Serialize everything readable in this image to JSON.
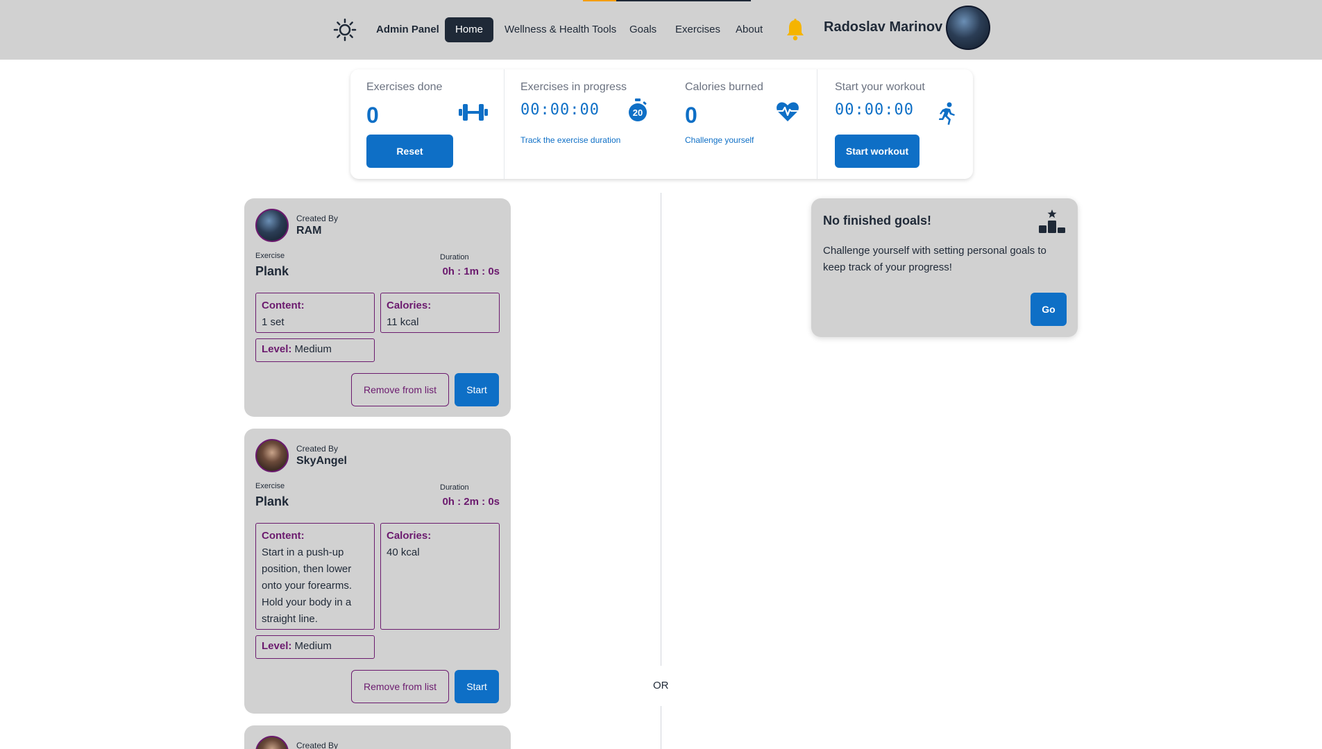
{
  "header": {
    "admin_panel": "Admin Panel",
    "nav": {
      "home": "Home",
      "wellness": "Wellness & Health Tools",
      "goals": "Goals",
      "exercises": "Exercises",
      "about": "About"
    },
    "username": "Radoslav Marinov",
    "icons": [
      "sun-icon",
      "bell-icon",
      "avatar"
    ]
  },
  "stats": {
    "exercises_done": {
      "title": "Exercises done",
      "value": "0",
      "button": "Reset",
      "icon": "dumbbell-icon"
    },
    "in_progress": {
      "title": "Exercises in progress",
      "timer": "00:00:00",
      "sub": "Track the exercise duration",
      "icon": "stopwatch-20-icon"
    },
    "calories": {
      "title": "Calories burned",
      "value": "0",
      "sub": "Challenge yourself",
      "icon": "heartbeat-icon"
    },
    "workout": {
      "title": "Start your workout",
      "timer": "00:00:00",
      "button": "Start workout",
      "icon": "running-icon"
    }
  },
  "cards": [
    {
      "created_by_label": "Created By",
      "author": "RAM",
      "exercise_label": "Exercise",
      "exercise": "Plank",
      "duration_label": "Duration",
      "duration": "0h : 1m : 0s",
      "content_label": "Content:",
      "content": "1 set",
      "calories_label": "Calories:",
      "calories": "11 kcal",
      "level_label": "Level:",
      "level": "Medium",
      "remove_label": "Remove from list",
      "start_label": "Start"
    },
    {
      "created_by_label": "Created By",
      "author": "SkyAngel",
      "exercise_label": "Exercise",
      "exercise": "Plank",
      "duration_label": "Duration",
      "duration": "0h : 2m : 0s",
      "content_label": "Content:",
      "content": "Start in a push-up position, then lower onto your forearms. Hold your body in a straight line.",
      "calories_label": "Calories:",
      "calories": "40 kcal",
      "level_label": "Level:",
      "level": "Medium",
      "remove_label": "Remove from list",
      "start_label": "Start"
    },
    {
      "created_by_label": "Created By"
    }
  ],
  "divider": {
    "or": "OR"
  },
  "goals": {
    "title": "No finished goals!",
    "text": "Challenge yourself with setting personal goals to keep track of your progress!",
    "button": "Go",
    "icon": "podium-icon"
  },
  "colors": {
    "header_bg": "#d1d1d1",
    "primary": "#0e6fc6",
    "accent_purple": "#6b1a6e",
    "nav_active": "#1f2937",
    "bell": "#f5b400"
  }
}
